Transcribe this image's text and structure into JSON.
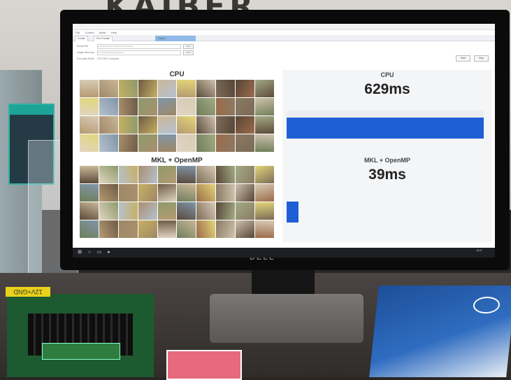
{
  "scene": {
    "banner_text": "KAIBER",
    "yellow_tag_text": "12V+GND",
    "monitor_brand": "DELL"
  },
  "app": {
    "menu": [
      "File",
      "Control",
      "Mode",
      "Help"
    ],
    "tabs": [
      "Create",
      "Run Parallel",
      "Output"
    ],
    "form": {
      "rows": [
        {
          "label": "Model File",
          "value": "C:\\Users\\demo\\models\\deploy.prototxt",
          "button": "Open"
        },
        {
          "label": "Image Directory",
          "value": "C:\\Users\\demo\\images\\pets",
          "button": "Open"
        },
        {
          "label": "Execution Mode",
          "value": "CPU  GPU  Compare",
          "button": ""
        }
      ],
      "start_button": "Start",
      "stop_button": "Stop"
    },
    "left_panel": {
      "cpu_heading": "CPU",
      "mkl_heading": "MKL + OpenMP"
    },
    "right_panel": {
      "cpu_label": "CPU",
      "cpu_value": "629ms",
      "mkl_label": "MKL + OpenMP",
      "mkl_value": "39ms",
      "cpu_bar_fraction": 1.0,
      "mkl_bar_fraction": 0.062,
      "bar_color": "#1f5fd6"
    },
    "taskbar": {
      "icons": [
        "windows-start-icon",
        "search-icon",
        "task-view-icon",
        "app-icon"
      ],
      "clock": "16:07"
    }
  },
  "thumb_colors": [
    "#8a7a63",
    "#b59a72",
    "#6e5a45",
    "#cfc2ad",
    "#5c4a3a",
    "#a88f6e",
    "#d8cbb5",
    "#7b6b57",
    "#9f8866",
    "#c9b79a",
    "#574636",
    "#e0d5c2",
    "#8d9a6b",
    "#a3aa85",
    "#6f7e5a",
    "#c7b062",
    "#e3d679",
    "#9b6b4a",
    "#b6c1cf",
    "#7f95a8"
  ]
}
